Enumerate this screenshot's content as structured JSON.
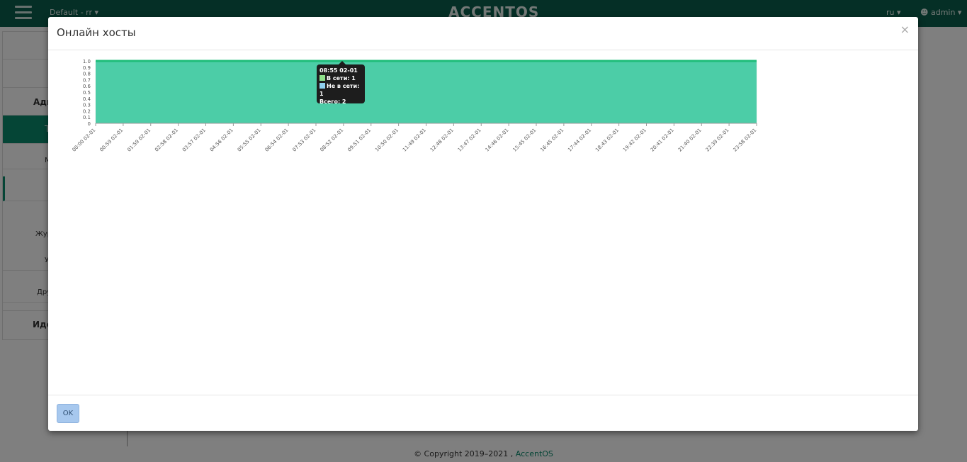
{
  "topbar": {
    "project": "Default - rr",
    "brand": "ACCENTOS",
    "lang": "ru",
    "user": "admin"
  },
  "background": {
    "sidebar_items": [
      "Адм",
      "Т",
      "М",
      "Жур",
      "У",
      "Дру",
      "Иден"
    ],
    "footer_text": "© Copyright 2019–2021 ,",
    "footer_link": "AccentOS"
  },
  "modal": {
    "title": "Онлайн хосты",
    "close": "×",
    "ok_label": "OK"
  },
  "colors": {
    "area_fill": "#4ccda7",
    "line": "#1fbd7a",
    "header": "#0b5e4c"
  },
  "tooltip": {
    "time": "08:55 02-01",
    "online": "В сети: 1",
    "offline": "Не в сети: 1",
    "total": "Всего: 2",
    "online_color": "#8ee08a",
    "offline_color": "#8fd0ee"
  },
  "chart_data": {
    "type": "area",
    "ylim": [
      0,
      1.0
    ],
    "yticks": [
      "0",
      "0.1",
      "0.2",
      "0.3",
      "0.4",
      "0.5",
      "0.6",
      "0.7",
      "0.8",
      "0.9",
      "1.0"
    ],
    "x": [
      "00:00 02-01",
      "00:59 02-01",
      "01:59 02-01",
      "02:58 02-01",
      "03:57 02-01",
      "04:56 02-01",
      "05:55 02-01",
      "06:54 02-01",
      "07:53 02-01",
      "08:52 02-01",
      "09:51 02-01",
      "10:50 02-01",
      "11:49 02-01",
      "12:48 02-01",
      "13:47 02-01",
      "14:46 02-01",
      "15:45 02-01",
      "16:45 02-01",
      "17:44 02-01",
      "18:43 02-01",
      "19:42 02-01",
      "20:41 02-01",
      "21:40 02-01",
      "22:39 02-01",
      "23:58 02-01"
    ],
    "series": [
      {
        "name": "В сети",
        "values": [
          1,
          1,
          1,
          1,
          1,
          1,
          1,
          1,
          1,
          1,
          1,
          1,
          1,
          1,
          1,
          1,
          1,
          1,
          1,
          1,
          1,
          1,
          1,
          1,
          1
        ]
      }
    ]
  }
}
